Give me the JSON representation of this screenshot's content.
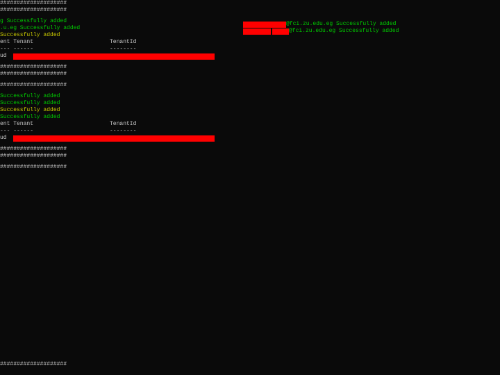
{
  "sep_row": "####################",
  "block1": {
    "l1_suffix": "g Successfully added",
    "l2_suffix": ".u.eg Successfully added",
    "l3_text": "Successfully added",
    "header_col1": "ent Tenant",
    "header_col2": "TenantId",
    "header_sep1": "--- ------",
    "header_sep2": "--------",
    "row_prefix": "ud  "
  },
  "block2": {
    "l1_suffix": "Successfully added",
    "l2_suffix": "Successfully added",
    "l3_text": "Successfully added",
    "l4_text": "Successfully added",
    "header_col1": "ent Tenant",
    "header_col2": "TenantId",
    "header_sep1": "--- ------",
    "header_sep2": "--------",
    "row_prefix": "ud  "
  },
  "right": {
    "l1_suffix": "@fci.zu.edu.eg Successfully added",
    "l2_suffix": "@fci.zu.edu.eg Successfully added"
  },
  "bottom_sep": "####################"
}
